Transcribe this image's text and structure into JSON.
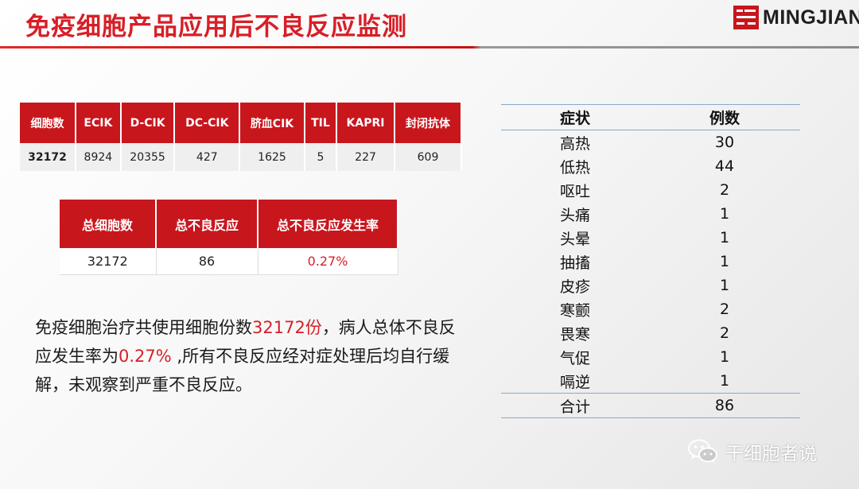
{
  "title": "免疫细胞产品应用后不良反应监测",
  "logo": {
    "text": "MINGJIAN"
  },
  "cell_table": {
    "headers": [
      "细胞数",
      "ECIK",
      "D-CIK",
      "DC-CIK",
      "脐血CIK",
      "TIL",
      "KAPRI",
      "封闭抗体"
    ],
    "values": [
      "32172",
      "8924",
      "20355",
      "427",
      "1625",
      "5",
      "227",
      "609"
    ]
  },
  "summary_table": {
    "headers": [
      "总细胞数",
      "总不良反应",
      "总不良反应发生率"
    ],
    "values": [
      "32172",
      "86",
      "0.27%"
    ]
  },
  "paragraph": {
    "part1": "免疫细胞治疗共使用细胞份数",
    "highlight1": "32172份",
    "part2": "，病人总体不良反应发生率为",
    "highlight2": "0.27%",
    "part3": " ,所有不良反应经对症处理后均自行缓解，未观察到严重不良反应。"
  },
  "symptom_table": {
    "headers": [
      "症状",
      "例数"
    ],
    "rows": [
      [
        "高热",
        "30"
      ],
      [
        "低热",
        "44"
      ],
      [
        "呕吐",
        "2"
      ],
      [
        "头痛",
        "1"
      ],
      [
        "头晕",
        "1"
      ],
      [
        "抽搐",
        "1"
      ],
      [
        "皮疹",
        "1"
      ],
      [
        "寒颤",
        "2"
      ],
      [
        "畏寒",
        "2"
      ],
      [
        "气促",
        "1"
      ],
      [
        "嗝逆",
        "1"
      ]
    ],
    "total_label": "合计",
    "total_value": "86"
  },
  "watermark": {
    "text": "干细胞者说",
    "icon": "wechat-icon"
  },
  "colors": {
    "accent": "#c8161d",
    "highlight_text": "#d81e27",
    "rule": "#8aa9c9"
  }
}
